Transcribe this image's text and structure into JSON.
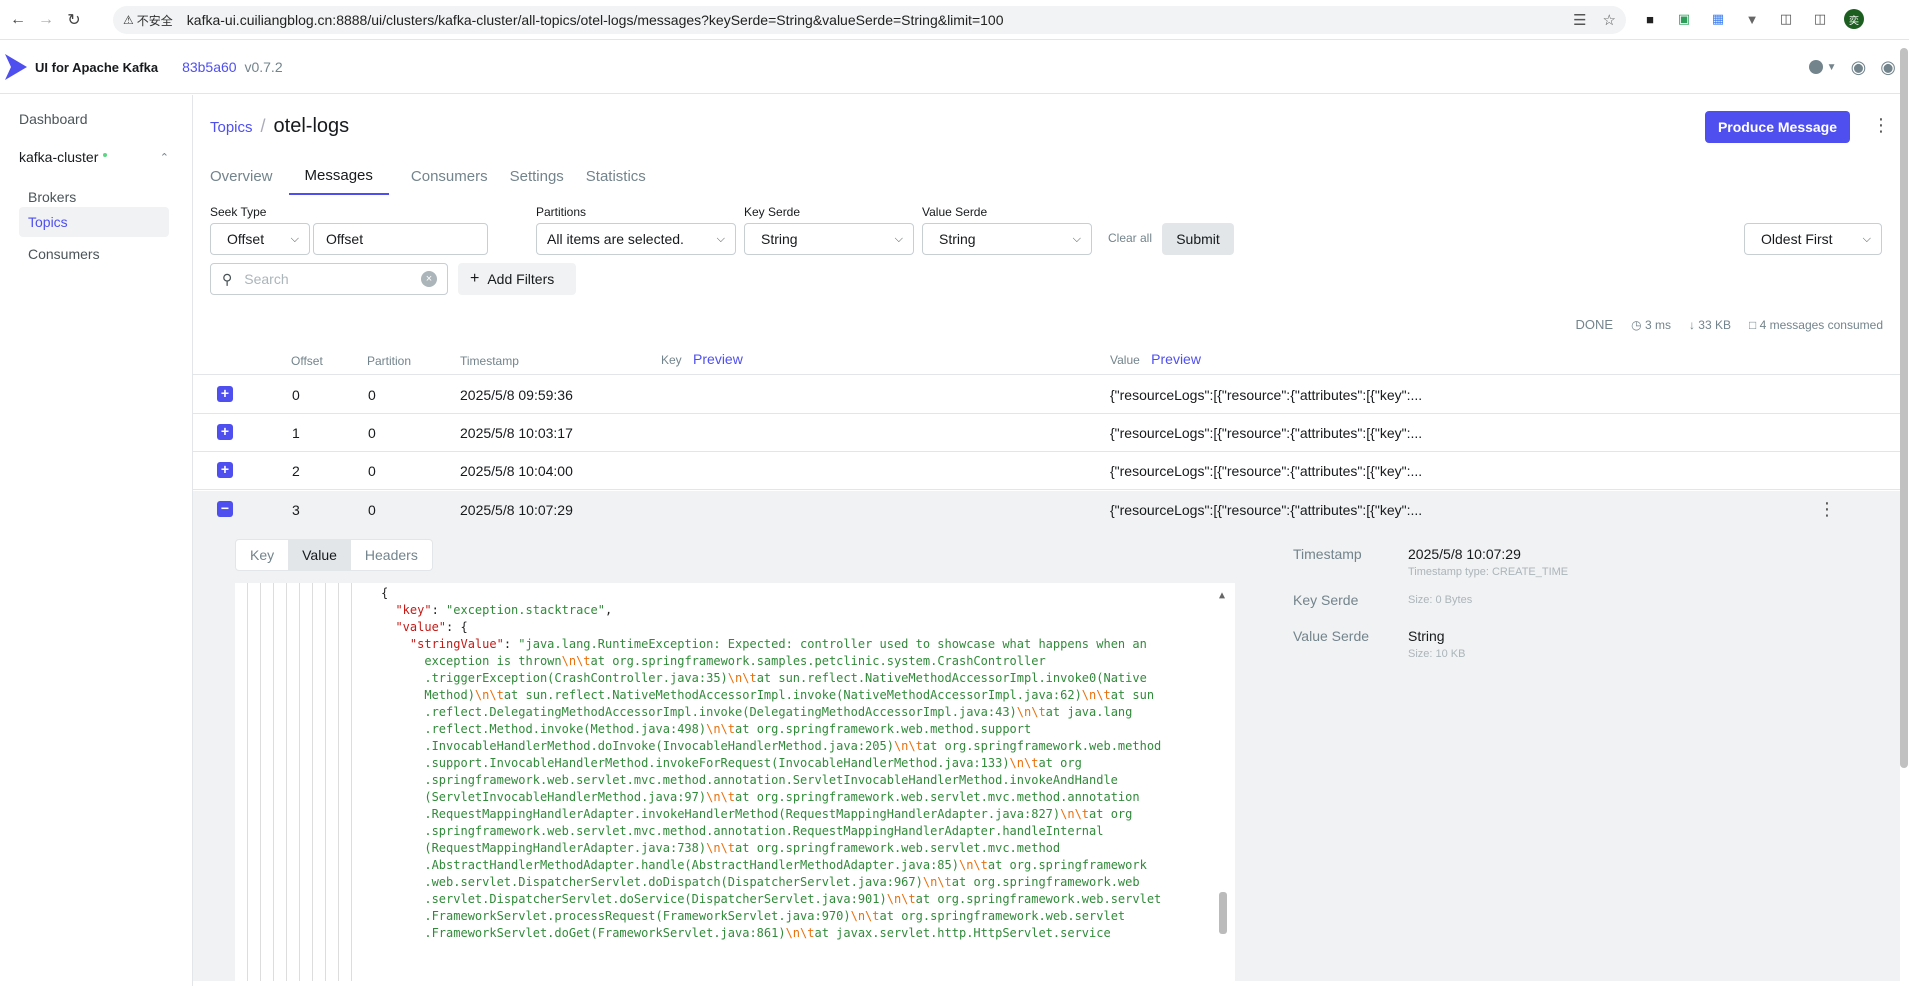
{
  "browser": {
    "insecure_label": "不安全",
    "url": "kafka-ui.cuiliangblog.cn:8888/ui/clusters/kafka-cluster/all-topics/otel-logs/messages?keySerde=String&valueSerde=String&limit=100",
    "avatar_text": "奕"
  },
  "app": {
    "name": "UI for Apache Kafka",
    "version_hash": "83b5a60",
    "version_num": "v0.7.2"
  },
  "sidebar": {
    "dashboard": "Dashboard",
    "cluster": "kafka-cluster",
    "items": [
      {
        "label": "Brokers"
      },
      {
        "label": "Topics"
      },
      {
        "label": "Consumers"
      }
    ]
  },
  "page": {
    "breadcrumb_parent": "Topics",
    "breadcrumb_sep": "/",
    "topic_name": "otel-logs",
    "produce_label": "Produce Message"
  },
  "tabs": [
    "Overview",
    "Messages",
    "Consumers",
    "Settings",
    "Statistics"
  ],
  "filters": {
    "seek_type_label": "Seek Type",
    "seek_type_value": "Offset",
    "offset_placeholder": "Offset",
    "partitions_label": "Partitions",
    "partitions_value": "All items are selected.",
    "key_serde_label": "Key Serde",
    "key_serde_value": "String",
    "value_serde_label": "Value Serde",
    "value_serde_value": "String",
    "clear_all": "Clear all",
    "submit": "Submit",
    "sort_value": "Oldest First",
    "search_placeholder": "Search",
    "add_filters": "Add Filters"
  },
  "stats": {
    "status": "DONE",
    "elapsed": "3 ms",
    "size": "33 KB",
    "consumed": "4 messages consumed"
  },
  "table": {
    "headers": {
      "offset": "Offset",
      "partition": "Partition",
      "timestamp": "Timestamp",
      "key": "Key",
      "value": "Value",
      "preview": "Preview"
    },
    "rows": [
      {
        "offset": "0",
        "partition": "0",
        "timestamp": "2025/5/8 09:59:36",
        "value": "{\"resourceLogs\":[{\"resource\":{\"attributes\":[{\"key\":..."
      },
      {
        "offset": "1",
        "partition": "0",
        "timestamp": "2025/5/8 10:03:17",
        "value": "{\"resourceLogs\":[{\"resource\":{\"attributes\":[{\"key\":..."
      },
      {
        "offset": "2",
        "partition": "0",
        "timestamp": "2025/5/8 10:04:00",
        "value": "{\"resourceLogs\":[{\"resource\":{\"attributes\":[{\"key\":..."
      },
      {
        "offset": "3",
        "partition": "0",
        "timestamp": "2025/5/8 10:07:29",
        "value": "{\"resourceLogs\":[{\"resource\":{\"attributes\":[{\"key\":..."
      }
    ]
  },
  "detail": {
    "tabs": [
      "Key",
      "Value",
      "Headers"
    ],
    "meta": {
      "timestamp_label": "Timestamp",
      "timestamp_value": "2025/5/8 10:07:29",
      "timestamp_type": "Timestamp type: CREATE_TIME",
      "key_serde_label": "Key Serde",
      "key_size": "Size: 0 Bytes",
      "value_serde_label": "Value Serde",
      "value_serde_value": "String",
      "value_size": "Size: 10 KB"
    },
    "code_lines": [
      [
        {
          "t": "p",
          "s": "{"
        }
      ],
      [
        {
          "t": "p",
          "s": "  "
        },
        {
          "t": "k",
          "s": "\"key\""
        },
        {
          "t": "p",
          "s": ": "
        },
        {
          "t": "s",
          "s": "\"exception.stacktrace\""
        },
        {
          "t": "p",
          "s": ","
        }
      ],
      [
        {
          "t": "p",
          "s": "  "
        },
        {
          "t": "k",
          "s": "\"value\""
        },
        {
          "t": "p",
          "s": ": {"
        }
      ],
      [
        {
          "t": "p",
          "s": "    "
        },
        {
          "t": "k",
          "s": "\"stringValue\""
        },
        {
          "t": "p",
          "s": ": "
        },
        {
          "t": "s",
          "s": "\"java.lang.RuntimeException: Expected: controller used to showcase what happens when an"
        }
      ],
      [
        {
          "t": "s",
          "s": "      exception is thrown"
        },
        {
          "t": "e",
          "s": "\\n\\t"
        },
        {
          "t": "s",
          "s": "at org.springframework.samples.petclinic.system.CrashController"
        }
      ],
      [
        {
          "t": "s",
          "s": "      .triggerException(CrashController.java:35)"
        },
        {
          "t": "e",
          "s": "\\n\\t"
        },
        {
          "t": "s",
          "s": "at sun.reflect.NativeMethodAccessorImpl.invoke0(Native"
        }
      ],
      [
        {
          "t": "s",
          "s": "      Method)"
        },
        {
          "t": "e",
          "s": "\\n\\t"
        },
        {
          "t": "s",
          "s": "at sun.reflect.NativeMethodAccessorImpl.invoke(NativeMethodAccessorImpl.java:62)"
        },
        {
          "t": "e",
          "s": "\\n\\t"
        },
        {
          "t": "s",
          "s": "at sun"
        }
      ],
      [
        {
          "t": "s",
          "s": "      .reflect.DelegatingMethodAccessorImpl.invoke(DelegatingMethodAccessorImpl.java:43)"
        },
        {
          "t": "e",
          "s": "\\n\\t"
        },
        {
          "t": "s",
          "s": "at java.lang"
        }
      ],
      [
        {
          "t": "s",
          "s": "      .reflect.Method.invoke(Method.java:498)"
        },
        {
          "t": "e",
          "s": "\\n\\t"
        },
        {
          "t": "s",
          "s": "at org.springframework.web.method.support"
        }
      ],
      [
        {
          "t": "s",
          "s": "      .InvocableHandlerMethod.doInvoke(InvocableHandlerMethod.java:205)"
        },
        {
          "t": "e",
          "s": "\\n\\t"
        },
        {
          "t": "s",
          "s": "at org.springframework.web.method"
        }
      ],
      [
        {
          "t": "s",
          "s": "      .support.InvocableHandlerMethod.invokeForRequest(InvocableHandlerMethod.java:133)"
        },
        {
          "t": "e",
          "s": "\\n\\t"
        },
        {
          "t": "s",
          "s": "at org"
        }
      ],
      [
        {
          "t": "s",
          "s": "      .springframework.web.servlet.mvc.method.annotation.ServletInvocableHandlerMethod.invokeAndHandle"
        }
      ],
      [
        {
          "t": "s",
          "s": "      (ServletInvocableHandlerMethod.java:97)"
        },
        {
          "t": "e",
          "s": "\\n\\t"
        },
        {
          "t": "s",
          "s": "at org.springframework.web.servlet.mvc.method.annotation"
        }
      ],
      [
        {
          "t": "s",
          "s": "      .RequestMappingHandlerAdapter.invokeHandlerMethod(RequestMappingHandlerAdapter.java:827)"
        },
        {
          "t": "e",
          "s": "\\n\\t"
        },
        {
          "t": "s",
          "s": "at org"
        }
      ],
      [
        {
          "t": "s",
          "s": "      .springframework.web.servlet.mvc.method.annotation.RequestMappingHandlerAdapter.handleInternal"
        }
      ],
      [
        {
          "t": "s",
          "s": "      (RequestMappingHandlerAdapter.java:738)"
        },
        {
          "t": "e",
          "s": "\\n\\t"
        },
        {
          "t": "s",
          "s": "at org.springframework.web.servlet.mvc.method"
        }
      ],
      [
        {
          "t": "s",
          "s": "      .AbstractHandlerMethodAdapter.handle(AbstractHandlerMethodAdapter.java:85)"
        },
        {
          "t": "e",
          "s": "\\n\\t"
        },
        {
          "t": "s",
          "s": "at org.springframework"
        }
      ],
      [
        {
          "t": "s",
          "s": "      .web.servlet.DispatcherServlet.doDispatch(DispatcherServlet.java:967)"
        },
        {
          "t": "e",
          "s": "\\n\\t"
        },
        {
          "t": "s",
          "s": "at org.springframework.web"
        }
      ],
      [
        {
          "t": "s",
          "s": "      .servlet.DispatcherServlet.doService(DispatcherServlet.java:901)"
        },
        {
          "t": "e",
          "s": "\\n\\t"
        },
        {
          "t": "s",
          "s": "at org.springframework.web.servlet"
        }
      ],
      [
        {
          "t": "s",
          "s": "      .FrameworkServlet.processRequest(FrameworkServlet.java:970)"
        },
        {
          "t": "e",
          "s": "\\n\\t"
        },
        {
          "t": "s",
          "s": "at org.springframework.web.servlet"
        }
      ],
      [
        {
          "t": "s",
          "s": "      .FrameworkServlet.doGet(FrameworkServlet.java:861)"
        },
        {
          "t": "e",
          "s": "\\n\\t"
        },
        {
          "t": "s",
          "s": "at javax.servlet.http.HttpServlet.service"
        }
      ]
    ]
  },
  "colors": {
    "accent": "#4f4ff0",
    "json_key": "#c41a16",
    "json_string": "#318a3a",
    "json_escape": "#e8700d"
  }
}
